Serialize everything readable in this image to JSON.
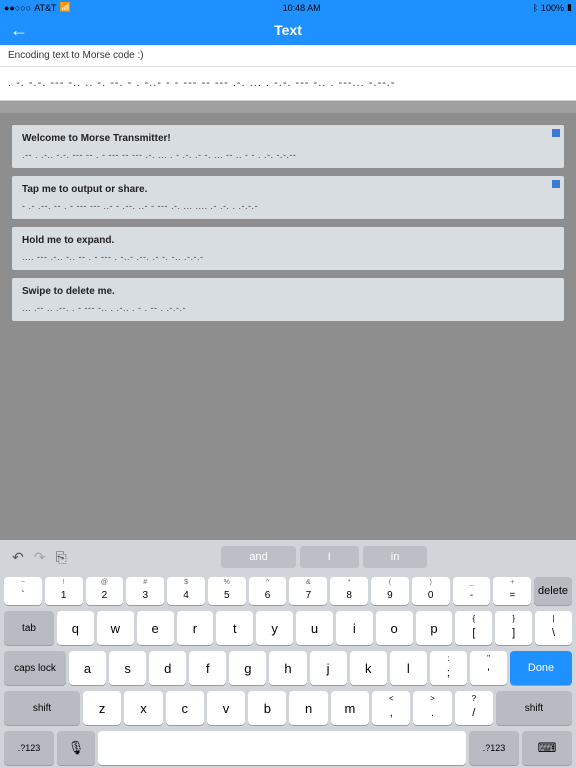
{
  "status": {
    "carrier": "AT&T",
    "signal": "●●○○○",
    "wifi": "⟂",
    "time": "10:48 AM",
    "bluetooth": "⌁",
    "battery": "100%"
  },
  "nav": {
    "title": "Text",
    "back": "←"
  },
  "input": {
    "text": "Encoding text to Morse code :)"
  },
  "morse_output": ". -. -.-. --- -.. .. -. --.   - . -..- -   - ---   -- --- .-. ... .   -.-. --- -.. .   ---... -.--.-",
  "cards": [
    {
      "title": "Welcome to Morse Transmitter!",
      "morse": ".-- . .-.. -.-. --- -- .   - ---   -- --- .-. ... .   - .-. .- -. ... -- .. - - . .-. -.-.--",
      "corner": true
    },
    {
      "title": "Tap me to output or share.",
      "morse": "- .- .--.   -- .   - ---   --- ..- - .--. ..- -   --- .-.   ... .... .- .-. . .-.-.-",
      "corner": true
    },
    {
      "title": "Hold me to expand.",
      "morse": ".... --- .-.. -..   -- .   - ---   . -..- .--. .- -. -.. .-.-.-",
      "corner": false
    },
    {
      "title": "Swipe to delete me.",
      "morse": "... .-- .. .--. .   - ---   -.. . .-.. . - .   -- . .-.-.-",
      "corner": false
    }
  ],
  "keyboard": {
    "tools": {
      "undo": "↶",
      "redo": "↷",
      "paste": "⎘"
    },
    "suggestions": [
      "and",
      "I",
      "in"
    ],
    "num_row": [
      {
        "s": "~",
        "m": "`"
      },
      {
        "s": "!",
        "m": "1"
      },
      {
        "s": "@",
        "m": "2"
      },
      {
        "s": "#",
        "m": "3"
      },
      {
        "s": "$",
        "m": "4"
      },
      {
        "s": "%",
        "m": "5"
      },
      {
        "s": "^",
        "m": "6"
      },
      {
        "s": "&",
        "m": "7"
      },
      {
        "s": "*",
        "m": "8"
      },
      {
        "s": "(",
        "m": "9"
      },
      {
        "s": ")",
        "m": "0"
      },
      {
        "s": "_",
        "m": "-"
      },
      {
        "s": "+",
        "m": "="
      }
    ],
    "delete": "delete",
    "tab": "tab",
    "row_q": [
      "q",
      "w",
      "e",
      "r",
      "t",
      "y",
      "u",
      "i",
      "o",
      "p"
    ],
    "row_q_extra": [
      {
        "s": "{",
        "m": "["
      },
      {
        "s": "}",
        "m": "]"
      },
      {
        "s": "|",
        "m": "\\"
      }
    ],
    "caps": "caps lock",
    "row_a": [
      "a",
      "s",
      "d",
      "f",
      "g",
      "h",
      "j",
      "k",
      "l"
    ],
    "row_a_extra": [
      {
        "s": ":",
        "m": ";"
      },
      {
        "s": "\"",
        "m": "'"
      }
    ],
    "done": "Done",
    "shift": "shift",
    "row_z": [
      "z",
      "x",
      "c",
      "v",
      "b",
      "n",
      "m"
    ],
    "row_z_extra": [
      {
        "s": "<",
        "m": ","
      },
      {
        "s": ">",
        "m": "."
      },
      {
        "s": "?",
        "m": "/"
      }
    ],
    "sym": ".?123",
    "mic": "🎤",
    "kb": "⌨"
  }
}
